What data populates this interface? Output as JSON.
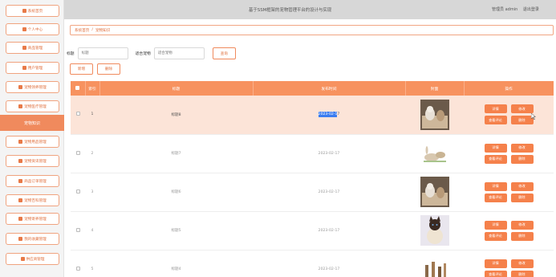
{
  "topbar": {
    "title": "基于SSM框架的宠物管理平台的设计与实现",
    "admin": "管理员 admin",
    "logout": "退出登录"
  },
  "sidebar": {
    "items": [
      "系统首页",
      "个人中心",
      "商品管理",
      "用户管理",
      "宠物领养管理",
      "宠物医疗管理",
      "宠物用品管理",
      "宠物资讯管理",
      "商品订单管理",
      "宠物百科管理",
      "宠物寄养管理",
      "我的收藏管理",
      "供应商管理"
    ],
    "active": "宠物知识"
  },
  "breadcrumb": {
    "home": "系统首页",
    "sep": "/",
    "current": "宠物知识"
  },
  "search": {
    "title_label": "标题",
    "title_placeholder": "标题",
    "pet_label": "适合宠物",
    "pet_placeholder": "适合宠物",
    "button": "查询"
  },
  "actions": {
    "add": "新增",
    "delete": "删除"
  },
  "table": {
    "headers": [
      "索引",
      "标题",
      "发布时间",
      "封面",
      "操作"
    ],
    "rows": [
      {
        "index": "1",
        "title": "标题8",
        "time": "2023-02-1",
        "time_end": "7",
        "image": "cat-toys",
        "selected": true
      },
      {
        "index": "2",
        "title": "标题7",
        "time": "2023-02-17",
        "image": "rabbits",
        "selected": false
      },
      {
        "index": "3",
        "title": "标题6",
        "time": "2023-02-17",
        "image": "cat-toys",
        "selected": false
      },
      {
        "index": "4",
        "title": "标题5",
        "time": "2023-02-17",
        "image": "siamese-cat",
        "selected": false
      },
      {
        "index": "5",
        "title": "标题4",
        "time": "2023-02-17",
        "image": "dogs",
        "selected": false
      }
    ],
    "ops": {
      "detail": "详情",
      "edit": "修改",
      "comments": "查看评论",
      "delete": "删除"
    }
  },
  "colors": {
    "accent": "#f7925f",
    "button": "#f5814b",
    "selected_row": "#fce4d8",
    "topbar": "#d7d7d7"
  }
}
